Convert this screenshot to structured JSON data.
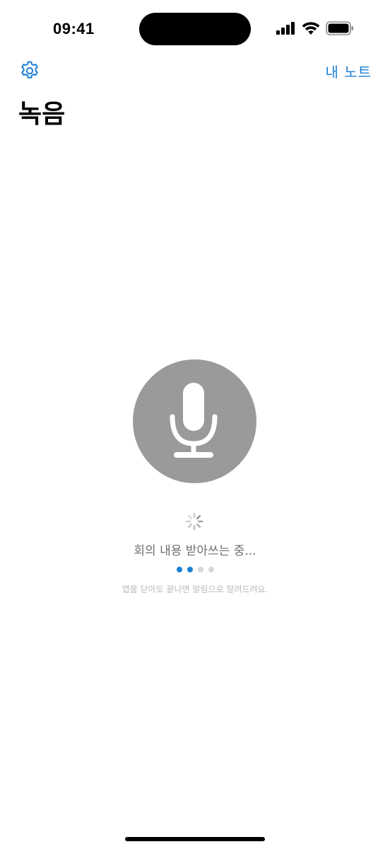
{
  "status_bar": {
    "time": "09:41"
  },
  "nav": {
    "settings_icon": "gear-icon",
    "right_button_label": "내 노트"
  },
  "page": {
    "title": "녹음"
  },
  "recording": {
    "mic_icon": "microphone-icon",
    "status_text": "회의 내용 받아쓰는 중...",
    "hint_text": "앱을 닫아도 끝나면 알림으로 알려드려요.",
    "progress_dots_total": 4,
    "progress_dots_active": 2
  },
  "colors": {
    "accent": "#1a7fd6",
    "mic_circle": "#9a9a9a",
    "status_text": "#6f6f6f",
    "hint_text": "#b8b8b8"
  }
}
